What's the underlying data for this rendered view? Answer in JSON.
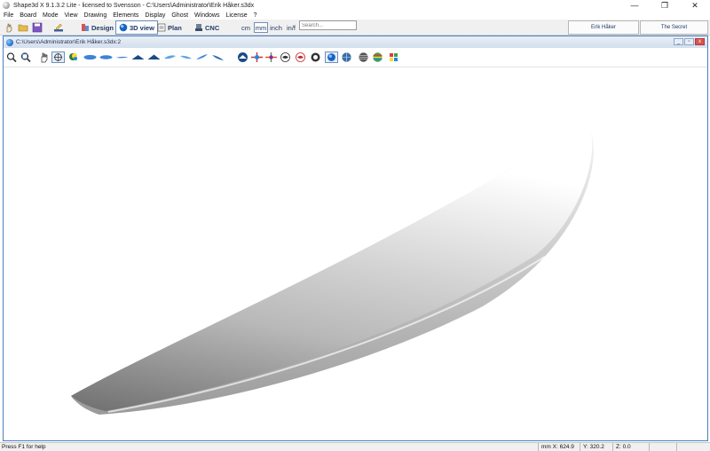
{
  "window": {
    "title": "Shape3d X 9.1.3.2 Lite - licensed to Svensson - C:\\Users\\Administrator\\Erik Håker.s3dx",
    "minimize": "—",
    "restore": "❐",
    "close": "✕"
  },
  "menu": [
    "File",
    "Board",
    "Mode",
    "View",
    "Drawing",
    "Elements",
    "Display",
    "Ghost",
    "Windows",
    "License",
    "?"
  ],
  "toolbar": {
    "modes": [
      {
        "label": "Design",
        "icon": "design-icon"
      },
      {
        "label": "3D view",
        "icon": "3d-view-icon"
      },
      {
        "label": "Plan",
        "icon": "plan-icon"
      },
      {
        "label": "CNC",
        "icon": "cnc-icon"
      }
    ],
    "active_mode": "3D view",
    "units": [
      "cm",
      "mm",
      "inch",
      "in/f"
    ],
    "active_unit": "mm",
    "search_placeholder": "Search..."
  },
  "panels": {
    "tab1": "Erik Håker",
    "tab2": "The Secret"
  },
  "document": {
    "title": "C:\\Users\\Administrator\\Erik Håker.s3dx:2"
  },
  "status": {
    "help": "Press F1 for help",
    "mm": "mm X: 624.9",
    "y": "Y: 320.2",
    "z": "Z: 0.0"
  },
  "colors": {
    "accent": "#4a7fbf",
    "board_light": "#f4f4f4",
    "board_mid": "#bdbdbd",
    "board_dark": "#7c7c7c"
  }
}
